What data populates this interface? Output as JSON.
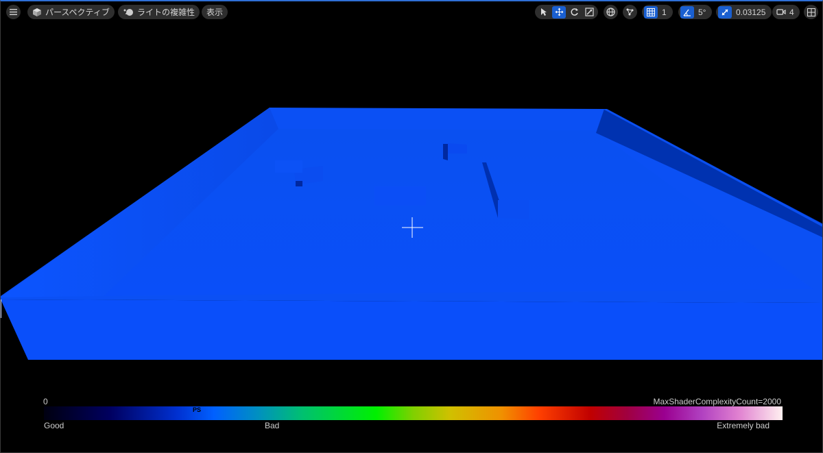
{
  "toolbar": {
    "perspective_label": "パースペクティブ",
    "lighting_label": "ライトの複雑性",
    "show_label": "表示",
    "grid_snap_value": "1",
    "rotation_snap_value": "5°",
    "scale_snap_value": "0.03125",
    "camera_speed_value": "4"
  },
  "legend": {
    "min_value": "0",
    "max_label": "MaxShaderComplexityCount=2000",
    "marker_label": "PS",
    "good_label": "Good",
    "bad_label": "Bad",
    "extremely_bad_label": "Extremely bad"
  },
  "colors": {
    "accent": "#1a5fd0",
    "floor": "#0a4ff5",
    "wall_dark": "#0032b0"
  }
}
